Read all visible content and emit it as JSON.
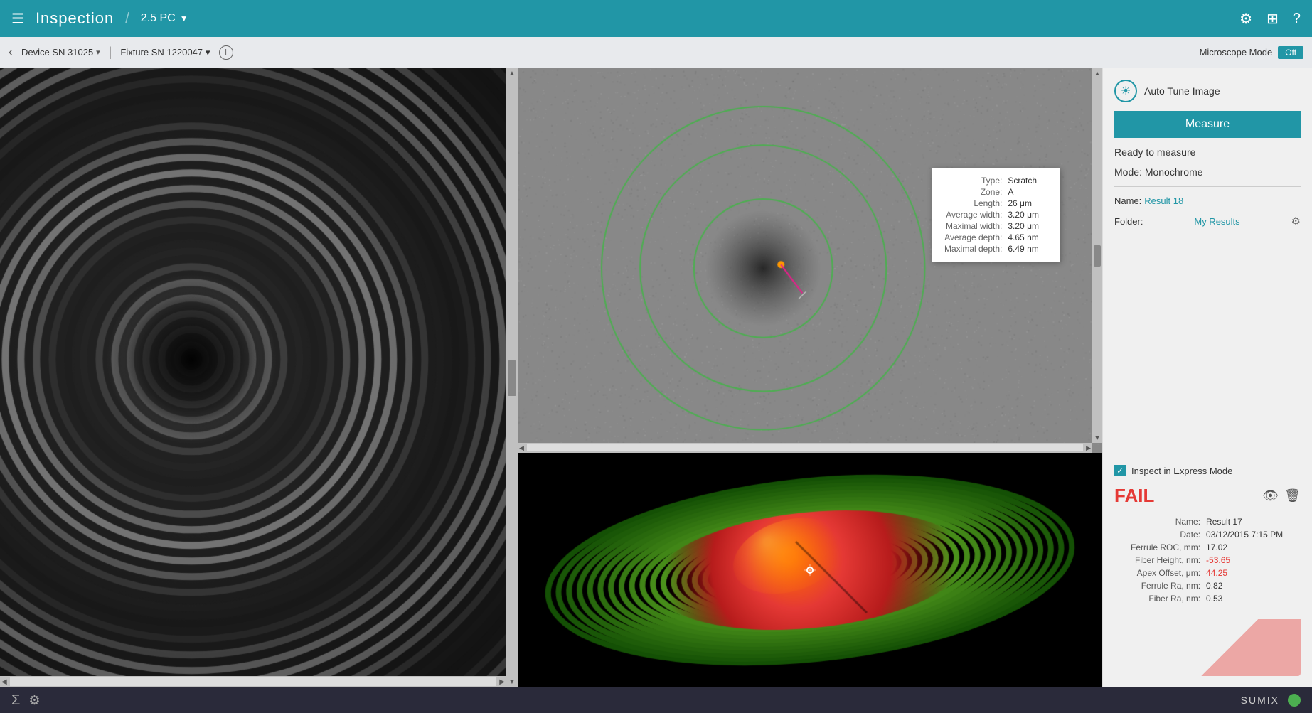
{
  "header": {
    "menu_icon": "☰",
    "title": "Inspection",
    "divider": "/",
    "profile": "2.5 PC",
    "profile_arrow": "▼",
    "icons": [
      "⚙",
      "⊞",
      "?"
    ]
  },
  "toolbar": {
    "back_arrow": "‹",
    "device_label": "Device SN 31025",
    "device_arrow": "▾",
    "separator": "|",
    "fixture_label": "Fixture SN   1220047",
    "fixture_arrow": "▾",
    "info_btn": "i",
    "microscope_mode_label": "Microscope Mode",
    "microscope_mode_value": "Off"
  },
  "sidebar": {
    "auto_tune_icon": "☀",
    "auto_tune_label": "Auto Tune Image",
    "measure_btn": "Measure",
    "status": "Ready to measure",
    "mode_label": "Mode:",
    "mode_value": "Monochrome",
    "name_label": "Name:",
    "name_value": "Result 18",
    "folder_label": "Folder:",
    "folder_value": "My Results",
    "folder_gear": "⚙",
    "express_mode_label": "Inspect in Express Mode",
    "fail_label": "FAIL",
    "result_name_label": "Name:",
    "result_name_value": "Result 17",
    "result_date_label": "Date:",
    "result_date_value": "03/12/2015 7:15 PM",
    "ferrule_roc_label": "Ferrule ROC, mm:",
    "ferrule_roc_value": "17.02",
    "fiber_height_label": "Fiber Height, nm:",
    "fiber_height_value": "-53.65",
    "apex_offset_label": "Apex Offset, μm:",
    "apex_offset_value": "44.25",
    "ferrule_ra_label": "Ferrule Ra, nm:",
    "ferrule_ra_value": "0.82",
    "fiber_ra_label": "Fiber Ra, nm:",
    "fiber_ra_value": "0.53"
  },
  "defect_tooltip": {
    "type_label": "Type:",
    "type_value": "Scratch",
    "zone_label": "Zone:",
    "zone_value": "A",
    "length_label": "Length:",
    "length_value": "26 μm",
    "avg_width_label": "Average width:",
    "avg_width_value": "3.20 μm",
    "max_width_label": "Maximal width:",
    "max_width_value": "3.20 μm",
    "avg_depth_label": "Average depth:",
    "avg_depth_value": "4.65 nm",
    "max_depth_label": "Maximal depth:",
    "max_depth_value": "6.49 nm"
  },
  "bottom_bar": {
    "sigma_icon": "Σ",
    "settings_icon": "⚙",
    "sumix_label": "SUMIX"
  }
}
